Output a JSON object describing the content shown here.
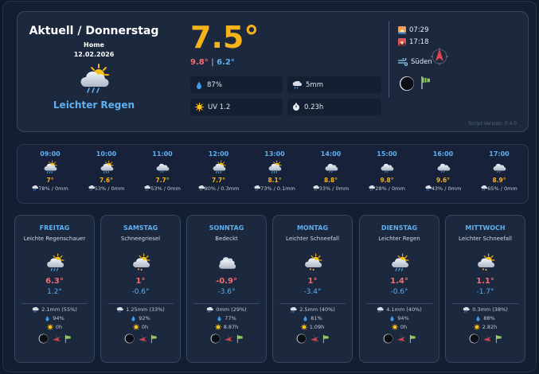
{
  "current": {
    "title": "Aktuell / Donnerstag",
    "location": "Home",
    "date": "12.02.2026",
    "condition": "Leichter Regen",
    "icon": "partly-cloudy-rain-icon",
    "temp": "7.5°",
    "max": "9.8°",
    "separator": "|",
    "min": "6.2°",
    "humidity": "87%",
    "precip": "5mm",
    "uv": "UV 1.2",
    "duration": "0.23h",
    "sunrise": "07:29",
    "sunset": "17:18",
    "wind_dir": "Süden",
    "version": "Script Version: 0.4.0"
  },
  "colors": {
    "accent_blue": "#5eb0f0",
    "temp_orange": "#f6b21a",
    "max_red": "#ee6d72",
    "card_bg": "#1b283d",
    "page_bg": "#121e31"
  },
  "hourly": [
    {
      "time": "09:00",
      "temp": "7°",
      "rain": "78% / 0mm",
      "icon": "partly-cloudy-rain-icon"
    },
    {
      "time": "10:00",
      "temp": "7.6°",
      "rain": "53% / 0mm",
      "icon": "partly-cloudy-rain-icon"
    },
    {
      "time": "11:00",
      "temp": "7.7°",
      "rain": "53% / 0mm",
      "icon": "cloud-drizzle-icon"
    },
    {
      "time": "12:00",
      "temp": "7.7°",
      "rain": "80% / 0.3mm",
      "icon": "partly-cloudy-rain-icon"
    },
    {
      "time": "13:00",
      "temp": "8.1°",
      "rain": "73% / 0.1mm",
      "icon": "partly-cloudy-rain-icon"
    },
    {
      "time": "14:00",
      "temp": "8.8°",
      "rain": "33% / 0mm",
      "icon": "cloud-drizzle-icon"
    },
    {
      "time": "15:00",
      "temp": "9.8°",
      "rain": "28% / 0mm",
      "icon": "cloud-drizzle-icon"
    },
    {
      "time": "16:00",
      "temp": "9.6°",
      "rain": "43% / 0mm",
      "icon": "cloud-drizzle-icon"
    },
    {
      "time": "17:00",
      "temp": "8.9°",
      "rain": "65% / 0mm",
      "icon": "cloud-drizzle-icon"
    }
  ],
  "daily": [
    {
      "name": "FREITAG",
      "cond": "Leichte Regenschauer",
      "icon": "partly-cloudy-rain-icon",
      "max": "6.3°",
      "min": "1.2°",
      "precip": "2.1mm (55%)",
      "humidity": "94%",
      "sun": "0h"
    },
    {
      "name": "SAMSTAG",
      "cond": "Schneegriesel",
      "icon": "partly-cloudy-snow-icon",
      "max": "1°",
      "min": "-0.6°",
      "precip": "1.25mm (33%)",
      "humidity": "92%",
      "sun": "0h"
    },
    {
      "name": "SONNTAG",
      "cond": "Bedeckt",
      "icon": "overcast-icon",
      "max": "-0.9°",
      "min": "-3.6°",
      "precip": "0mm (29%)",
      "humidity": "77%",
      "sun": "8.87h"
    },
    {
      "name": "MONTAG",
      "cond": "Leichter Schneefall",
      "icon": "partly-cloudy-snow-icon",
      "max": "1°",
      "min": "-3.4°",
      "precip": "2.5mm (40%)",
      "humidity": "81%",
      "sun": "1.09h"
    },
    {
      "name": "DIENSTAG",
      "cond": "Leichter Regen",
      "icon": "partly-cloudy-rain-icon",
      "max": "1.4°",
      "min": "-0.6°",
      "precip": "4.1mm (40%)",
      "humidity": "94%",
      "sun": "0h"
    },
    {
      "name": "MITTWOCH",
      "cond": "Leichter Schneefall",
      "icon": "partly-cloudy-snow-icon",
      "max": "1.1°",
      "min": "-1.7°",
      "precip": "0.3mm (38%)",
      "humidity": "88%",
      "sun": "2.82h"
    }
  ]
}
